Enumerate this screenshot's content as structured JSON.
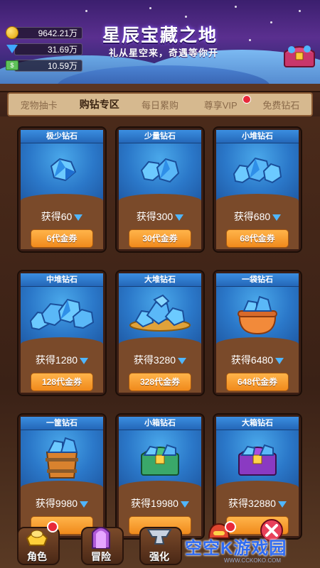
{
  "header": {
    "title": "星辰宝藏之地",
    "subtitle": "礼从星空来，奇遇等你开",
    "currencies": [
      {
        "icon": "gold-coin-icon",
        "value": "9642.21万"
      },
      {
        "icon": "diamond-icon",
        "value": "31.69万"
      },
      {
        "icon": "cash-bill-icon",
        "value": "10.59万"
      }
    ]
  },
  "tabs": [
    {
      "label": "宠物抽卡",
      "active": false
    },
    {
      "label": "购钻专区",
      "active": true
    },
    {
      "label": "每日累购",
      "active": false
    },
    {
      "label": "尊享VIP",
      "active": false,
      "badge": true
    },
    {
      "label": "免费钻石",
      "active": false
    }
  ],
  "cards": [
    {
      "name": "极少钻石",
      "gain": "获得60",
      "price": "6代金券",
      "art": "gems-1"
    },
    {
      "name": "少量钻石",
      "gain": "获得300",
      "price": "30代金券",
      "art": "gems-2"
    },
    {
      "name": "小堆钻石",
      "gain": "获得680",
      "price": "68代金券",
      "art": "gems-3"
    },
    {
      "name": "中堆钻石",
      "gain": "获得1280",
      "price": "128代金券",
      "art": "gems-4"
    },
    {
      "name": "大堆钻石",
      "gain": "获得3280",
      "price": "328代金券",
      "art": "gems-plate"
    },
    {
      "name": "一袋钻石",
      "gain": "获得6480",
      "price": "648代金券",
      "art": "gem-bag"
    },
    {
      "name": "一筐钻石",
      "gain": "获得9980",
      "price": "",
      "art": "gem-barrel"
    },
    {
      "name": "小箱钻石",
      "gain": "获得19980",
      "price": "",
      "art": "green-chest"
    },
    {
      "name": "大箱钻石",
      "gain": "获得32880",
      "price": "",
      "art": "purple-chest"
    }
  ],
  "bottom_nav": [
    {
      "label": "角色",
      "icon": "gold-ingot-icon",
      "badge": true
    },
    {
      "label": "冒险",
      "icon": "portal-door-icon",
      "badge": false
    },
    {
      "label": "强化",
      "icon": "anvil-icon",
      "badge": false
    },
    {
      "label": "",
      "icon": "robot-helmet-icon",
      "badge": true
    },
    {
      "label": "",
      "icon": "close-x-icon",
      "badge": false
    }
  ],
  "watermark": {
    "text": "空空K游戏园",
    "sub": "WWW.CCKOKO.COM"
  }
}
